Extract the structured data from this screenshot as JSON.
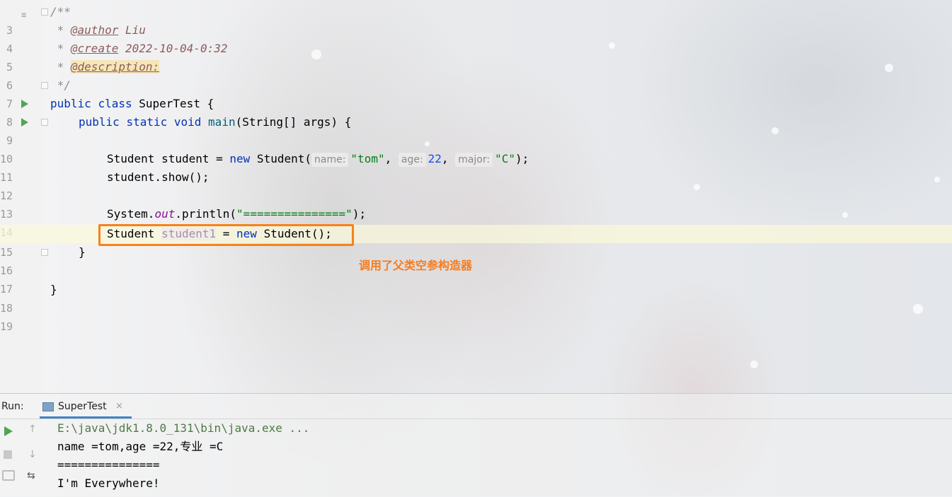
{
  "editor": {
    "lines": [
      {
        "num": "3",
        "text": "/**"
      },
      {
        "num": "4",
        "prefix": " * ",
        "tag": "@author",
        "value": " Liu"
      },
      {
        "num": "5",
        "prefix": " * ",
        "tag": "@create",
        "value": " 2022-10-04-0:32"
      },
      {
        "num": "6",
        "prefix": " * ",
        "tag": "@description:"
      },
      {
        "num": "7",
        "text": " */"
      },
      {
        "num": "8",
        "kw1": "public",
        "kw2": "class",
        "name": "SuperTest",
        "rest": " {"
      },
      {
        "num": "9",
        "kw1": "public",
        "kw2": "static",
        "kw3": "void",
        "name": "main",
        "rest": "(String[] args) {"
      },
      {
        "num": "10"
      },
      {
        "num": "11",
        "t1": "Student student = ",
        "kw": "new",
        "t2": " Student(",
        "hint_name": "name:",
        "s_name": "\"tom\"",
        "comma1": ", ",
        "hint_age": "age:",
        "n_age": "22",
        "comma2": ", ",
        "hint_major": "major:",
        "s_major": "\"C\"",
        "t3": ");"
      },
      {
        "num": "12",
        "text": "student.show();"
      },
      {
        "num": "13"
      },
      {
        "num": "14",
        "t1": "System.",
        "field": "out",
        "t2": ".println(",
        "str": "\"===============\"",
        "t3": ");"
      },
      {
        "num": "15",
        "t1": "Student ",
        "unused": "student1",
        "t2": " = ",
        "kw": "new",
        "t3": " Student();"
      },
      {
        "num": "16",
        "text": "}"
      },
      {
        "num": "17"
      },
      {
        "num": "18",
        "text": "}"
      },
      {
        "num": "19"
      }
    ]
  },
  "annotation": "调用了父类空参构造器",
  "run_panel": {
    "label": "Run:",
    "tab_label": "SuperTest",
    "tab_close": "×",
    "output": [
      "E:\\java\\jdk1.8.0_131\\bin\\java.exe ...",
      "name =tom,age =22,专业 =C",
      "===============",
      "I'm Everywhere!"
    ]
  },
  "icons": {
    "gutter_run": "run-arrow-icon",
    "rerun": "play-icon",
    "stop": "stop-icon",
    "camera": "camera-icon",
    "scroll_up": "arrow-up-icon",
    "scroll_down": "arrow-down-icon",
    "soft_wrap": "soft-wrap-icon"
  }
}
